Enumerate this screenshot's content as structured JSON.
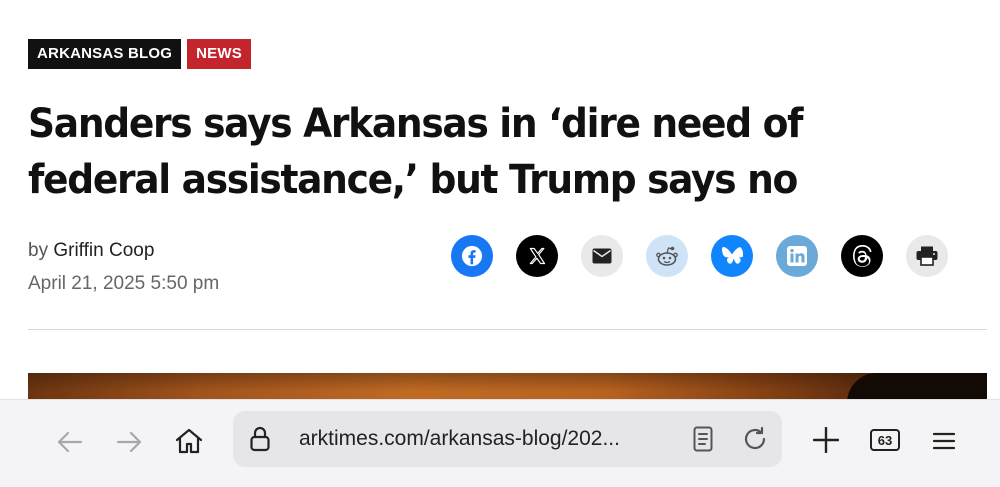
{
  "article": {
    "section_tag": "ARKANSAS BLOG",
    "category_tag": "NEWS",
    "headline": "Sanders says Arkansas in ‘dire need of federal assistance,’ but Trump says no",
    "byline_prefix": "by",
    "author": "Griffin Coop",
    "date": "April 21, 2025 5:50 pm"
  },
  "share": [
    {
      "name": "facebook-icon",
      "bg": "#1877f2"
    },
    {
      "name": "x-icon",
      "bg": "#000000"
    },
    {
      "name": "email-icon",
      "bg": "#e9e9ea"
    },
    {
      "name": "reddit-icon",
      "bg": "#cfe3f7"
    },
    {
      "name": "bluesky-icon",
      "bg": "#1185fe"
    },
    {
      "name": "linkedin-icon",
      "bg": "#6aa9d8"
    },
    {
      "name": "threads-icon",
      "bg": "#000000"
    },
    {
      "name": "print-icon",
      "bg": "#e9e9ea"
    }
  ],
  "browser": {
    "url": "arktimes.com/arkansas-blog/202...",
    "tab_count": "63"
  }
}
